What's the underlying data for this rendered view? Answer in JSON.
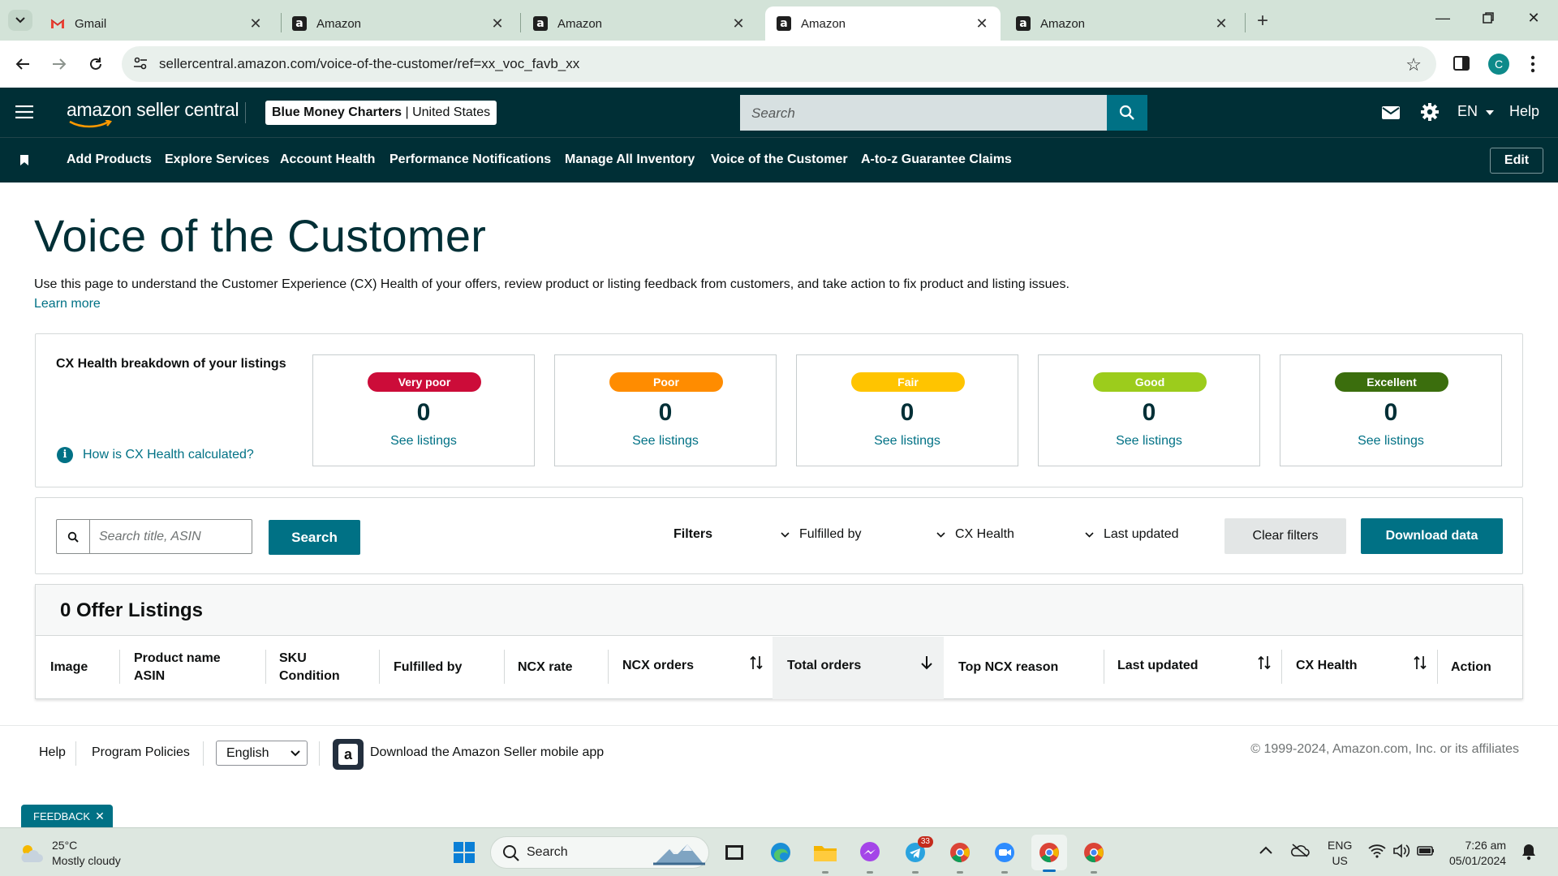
{
  "browser": {
    "tabs": [
      {
        "label": "Gmail",
        "favicon": "gmail-icon",
        "active": false
      },
      {
        "label": "Amazon",
        "favicon": "amazon-icon",
        "active": false
      },
      {
        "label": "Amazon",
        "favicon": "amazon-icon",
        "active": false
      },
      {
        "label": "Amazon",
        "favicon": "amazon-icon",
        "active": true
      },
      {
        "label": "Amazon",
        "favicon": "amazon-icon",
        "active": false
      }
    ],
    "url": "sellercentral.amazon.com/voice-of-the-customer/ref=xx_voc_favb_xx",
    "profile_initial": "C"
  },
  "header": {
    "logo": "amazon seller central",
    "store_name": "Blue Money Charters",
    "store_region": "United States",
    "search_placeholder": "Search",
    "language": "EN",
    "help": "Help"
  },
  "nav": {
    "links": [
      "Add Products",
      "Explore Services",
      "Account Health",
      "Performance Notifications",
      "Manage All Inventory",
      "Voice of the Customer",
      "A-to-z Guarantee Claims"
    ],
    "edit": "Edit"
  },
  "page": {
    "title": "Voice of the Customer",
    "intro": "Use this page to understand the Customer Experience (CX) Health of your offers, review product or listing feedback from customers, and take action to fix product and listing issues.",
    "learn_more": "Learn more"
  },
  "cx_health": {
    "title": "CX Health breakdown of your listings",
    "how_link": "How is CX Health calculated?",
    "cards": [
      {
        "label": "Very poor",
        "count": "0",
        "link": "See listings",
        "color": "#cc0c39"
      },
      {
        "label": "Poor",
        "count": "0",
        "link": "See listings",
        "color": "#ff8c00"
      },
      {
        "label": "Fair",
        "count": "0",
        "link": "See listings",
        "color": "#ffc400"
      },
      {
        "label": "Good",
        "count": "0",
        "link": "See listings",
        "color": "#9ccc1c"
      },
      {
        "label": "Excellent",
        "count": "0",
        "link": "See listings",
        "color": "#3b6e0d"
      }
    ]
  },
  "filters": {
    "search_placeholder": "Search title, ASIN",
    "search_button": "Search",
    "label": "Filters",
    "dropdowns": [
      "Fulfilled by",
      "CX Health",
      "Last updated"
    ],
    "clear": "Clear filters",
    "download": "Download data"
  },
  "listings": {
    "title": "0 Offer Listings",
    "columns": [
      {
        "line1": "Image",
        "line2": ""
      },
      {
        "line1": "Product name",
        "line2": "ASIN"
      },
      {
        "line1": "SKU",
        "line2": "Condition"
      },
      {
        "line1": "Fulfilled by",
        "line2": ""
      },
      {
        "line1": "NCX rate",
        "line2": ""
      },
      {
        "line1": "NCX orders",
        "line2": ""
      },
      {
        "line1": "Total orders",
        "line2": ""
      },
      {
        "line1": "Top NCX reason",
        "line2": ""
      },
      {
        "line1": "Last updated",
        "line2": ""
      },
      {
        "line1": "CX Health",
        "line2": ""
      },
      {
        "line1": "Action",
        "line2": ""
      }
    ]
  },
  "footer": {
    "help": "Help",
    "policies": "Program Policies",
    "language": "English",
    "app_text": "Download the Amazon Seller mobile app",
    "copyright": "© 1999-2024, Amazon.com, Inc. or its affiliates",
    "feedback": "FEEDBACK"
  },
  "taskbar": {
    "temp": "25°C",
    "weather": "Mostly cloudy",
    "search": "Search",
    "telegram_badge": "33",
    "lang1": "ENG",
    "lang2": "US",
    "time": "7:26 am",
    "date": "05/01/2024"
  }
}
